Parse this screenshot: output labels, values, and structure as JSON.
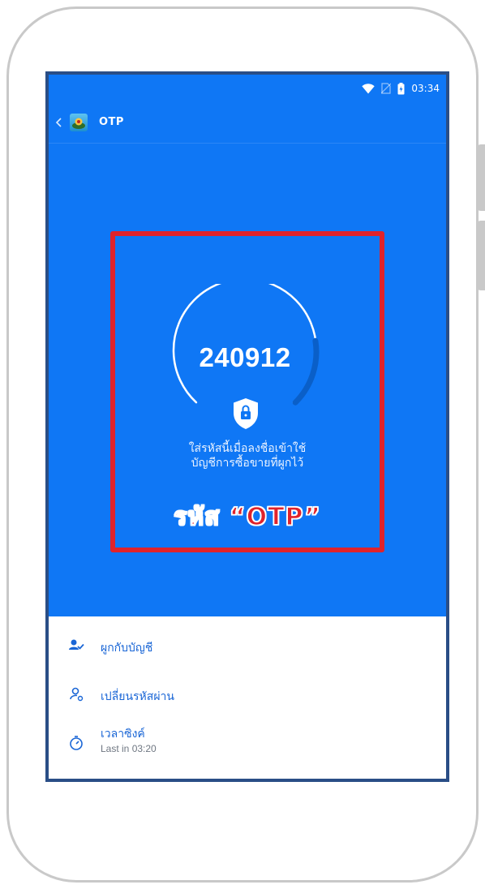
{
  "status_bar": {
    "time": "03:34",
    "icons": [
      "wifi-icon",
      "no-sim-icon",
      "battery-icon"
    ]
  },
  "app_bar": {
    "title": "OTP",
    "icon": "app-logo-icon",
    "back_icon": "chevron-left-icon"
  },
  "otp": {
    "code": "240912",
    "instruction_line1": "ใส่รหัสนี้เมื่อลงชื่อเข้าใช้",
    "instruction_line2": "บัญชีการซื้อขายที่ผูกไว้",
    "timer_progress": 0.2,
    "shield_icon": "shield-lock-icon"
  },
  "annotation": {
    "label": "รหัส “OTP”",
    "border_color": "#e0232b"
  },
  "menu": {
    "items": [
      {
        "label": "ผูกกับบัญชี",
        "icon": "link-account-icon"
      },
      {
        "label": "เปลี่ยนรหัสผ่าน",
        "icon": "change-password-icon"
      },
      {
        "label": "เวลาซิงค์",
        "sublabel": "Last in 03:20",
        "icon": "sync-timer-icon"
      }
    ]
  },
  "colors": {
    "primary": "#0f77f5",
    "accent_text": "#1a66d6",
    "frame": "#2a4e86",
    "highlight": "#e0232b"
  }
}
